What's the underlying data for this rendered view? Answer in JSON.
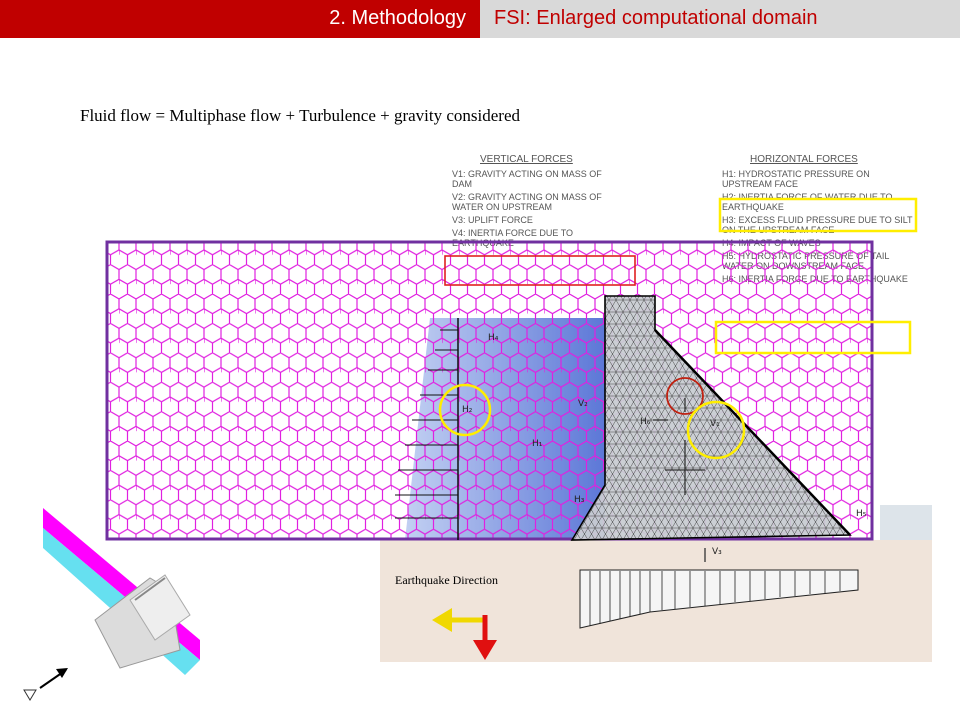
{
  "header": {
    "section": "2. Methodology",
    "title": "FSI: Enlarged computational domain"
  },
  "equation": "Fluid flow = Multiphase flow + Turbulence + gravity considered",
  "vertical_forces": {
    "heading": "Vertical Forces",
    "items": [
      "V1: Gravity acting on mass of dam",
      "V2: Gravity acting on mass of water on upstream",
      "V3: Uplift force",
      "V4: Inertia force due to earthquake"
    ]
  },
  "horizontal_forces": {
    "heading": "Horizontal Forces",
    "items": [
      "H1: Hydrostatic pressure on upstream face",
      "H2: Inertia force of water due to earthquake",
      "H3: Excess fluid pressure due to silt on the upstream face",
      "H4: Impact of waves",
      "H5: Hydrostatic pressure of tail water on downstream face",
      "H6: Inertia force due to earthquake"
    ]
  },
  "earthquake_label": "Earthquake Direction",
  "colors": {
    "header_red": "#c00000",
    "header_gray": "#d9d9d9",
    "mesh_magenta": "#e020e0",
    "domain_border": "#7030a0",
    "highlight_yellow": "#ffee00",
    "highlight_red": "#e02020",
    "water_blue": "#4a6fd8"
  }
}
